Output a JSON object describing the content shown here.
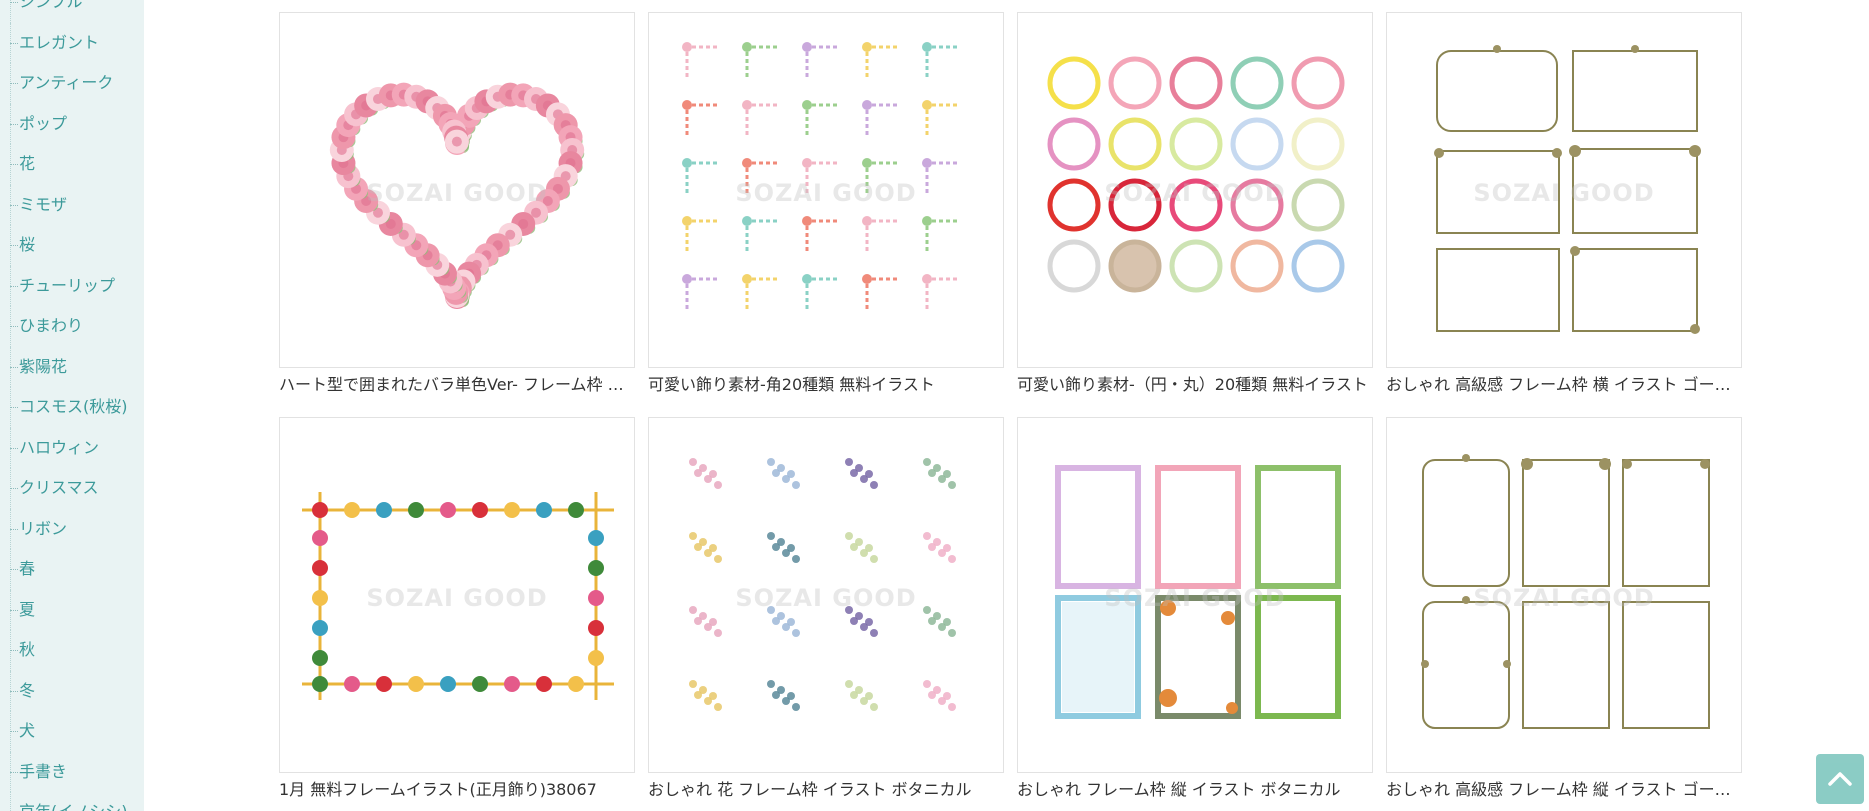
{
  "sidebar": {
    "items": [
      {
        "label": "シンプル"
      },
      {
        "label": "エレガント"
      },
      {
        "label": "アンティーク"
      },
      {
        "label": "ポップ"
      },
      {
        "label": "花"
      },
      {
        "label": "ミモザ"
      },
      {
        "label": "桜"
      },
      {
        "label": "チューリップ"
      },
      {
        "label": "ひまわり"
      },
      {
        "label": "紫陽花"
      },
      {
        "label": "コスモス(秋桜)"
      },
      {
        "label": "ハロウィン"
      },
      {
        "label": "クリスマス"
      },
      {
        "label": "リボン"
      },
      {
        "label": "春"
      },
      {
        "label": "夏"
      },
      {
        "label": "秋"
      },
      {
        "label": "冬"
      },
      {
        "label": "犬"
      },
      {
        "label": "手書き"
      },
      {
        "label": "京年(イノシシ)"
      }
    ]
  },
  "gallery": {
    "watermark": "SOZAI GOOD",
    "items": [
      {
        "title": "ハート型で囲まれたバラ単色Ver- フレーム枠 無料イラスト",
        "icon": "heart-rose-wreath"
      },
      {
        "title": "可愛い飾り素材-角20種類 無料イラスト",
        "icon": "corner-decorations"
      },
      {
        "title": "可愛い飾り素材-（円・丸）20種類 無料イラスト",
        "icon": "circle-wreaths"
      },
      {
        "title": "おしゃれ 高級感 フレーム枠 横 イラスト ゴールド",
        "icon": "gold-frames-horizontal"
      },
      {
        "title": "1月 無料フレームイラスト(正月飾り)38067",
        "icon": "new-year-frame"
      },
      {
        "title": "おしゃれ 花 フレーム枠 イラスト ボタニカル",
        "icon": "botanical-corners"
      },
      {
        "title": "おしゃれ フレーム枠 縦 イラスト ボタニカル",
        "icon": "botanical-frames-vertical"
      },
      {
        "title": "おしゃれ 高級感 フレーム枠 縦 イラスト ゴールド",
        "icon": "gold-frames-vertical"
      }
    ]
  },
  "page_top_button": {
    "icon": "chevron-up-icon"
  }
}
